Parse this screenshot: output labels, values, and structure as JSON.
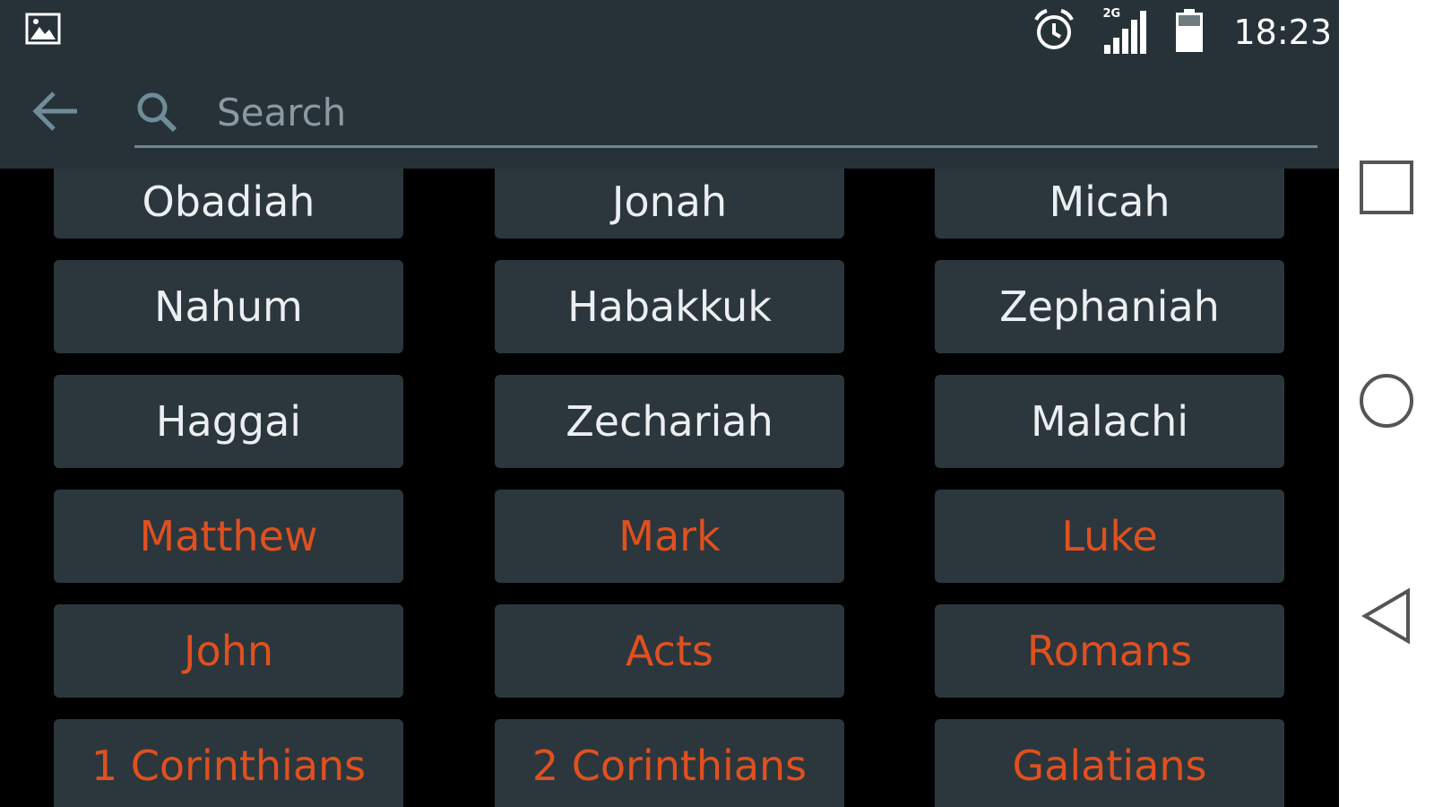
{
  "status_bar": {
    "time": "18:23",
    "network_label": "2G",
    "icons": [
      "gallery-icon",
      "alarm-icon",
      "signal-icon",
      "battery-icon"
    ]
  },
  "toolbar": {
    "search_placeholder": "Search",
    "search_value": ""
  },
  "books": [
    {
      "label": "Obadiah",
      "testament": "old"
    },
    {
      "label": "Jonah",
      "testament": "old"
    },
    {
      "label": "Micah",
      "testament": "old"
    },
    {
      "label": "Nahum",
      "testament": "old"
    },
    {
      "label": "Habakkuk",
      "testament": "old"
    },
    {
      "label": "Zephaniah",
      "testament": "old"
    },
    {
      "label": "Haggai",
      "testament": "old"
    },
    {
      "label": "Zechariah",
      "testament": "old"
    },
    {
      "label": "Malachi",
      "testament": "old"
    },
    {
      "label": "Matthew",
      "testament": "new"
    },
    {
      "label": "Mark",
      "testament": "new"
    },
    {
      "label": "Luke",
      "testament": "new"
    },
    {
      "label": "John",
      "testament": "new"
    },
    {
      "label": "Acts",
      "testament": "new"
    },
    {
      "label": "Romans",
      "testament": "new"
    },
    {
      "label": "1 Corinthians",
      "testament": "new"
    },
    {
      "label": "2 Corinthians",
      "testament": "new"
    },
    {
      "label": "Galatians",
      "testament": "new"
    }
  ],
  "colors": {
    "old_testament_text": "#eceff1",
    "new_testament_text": "#e0501f",
    "bar_background": "#273238",
    "button_background": "#2b373d"
  },
  "nav_bar": {
    "icons": [
      "recents-icon",
      "home-icon",
      "back-nav-icon"
    ]
  }
}
